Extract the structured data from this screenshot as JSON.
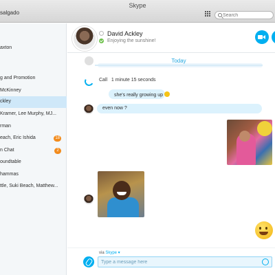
{
  "window": {
    "title": "Skype",
    "account": "salgado"
  },
  "search": {
    "placeholder": "Search"
  },
  "sidebar": {
    "items": [
      {
        "label": "axton"
      },
      {
        "label": "g and Promotion"
      },
      {
        "label": "McKinney"
      },
      {
        "label": "ckley",
        "active": true
      },
      {
        "label": "Kramer, Lee Murphy, MJ..."
      },
      {
        "label": "rman"
      },
      {
        "label": "each, Eric Ishida",
        "badge": "18"
      },
      {
        "label": "n Chat",
        "badge": "2"
      },
      {
        "label": "oundtable"
      },
      {
        "label": "hammas"
      },
      {
        "label": "ttle, Suki Beach, Matthew..."
      }
    ]
  },
  "header": {
    "name": "David Ackley",
    "mood": "Enjoying the sunshine!"
  },
  "conversation": {
    "day_label": "Today",
    "call_label": "Call",
    "call_duration": "1 minute 15 seconds",
    "messages": [
      {
        "text": "she's really growing up"
      },
      {
        "text": "even now ?"
      }
    ]
  },
  "compose": {
    "via_label": "via",
    "via_service": "Skype ▾",
    "placeholder": "Type a message here"
  },
  "colors": {
    "accent": "#00aff0",
    "bubble": "#dcf2fd",
    "badge": "#f28b1c",
    "active_row": "#cfe8f9"
  }
}
